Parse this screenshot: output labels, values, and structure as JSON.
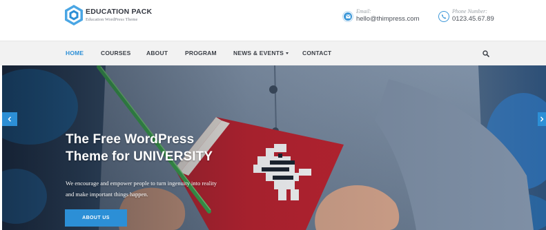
{
  "brand": {
    "name": "EDUCATION PACK",
    "tagline": "Education WordPress Theme",
    "accent_color": "#2c8fd6"
  },
  "contact": {
    "email_label": "Email:",
    "email_value": "hello@thimpress.com",
    "phone_label": "Phone Number:",
    "phone_value": "0123.45.67.89"
  },
  "nav": {
    "items": [
      {
        "label": "HOME",
        "active": true
      },
      {
        "label": "COURSES",
        "active": false
      },
      {
        "label": "ABOUT",
        "active": false
      },
      {
        "label": "PROGRAM",
        "active": false
      },
      {
        "label": "NEWS & EVENTS",
        "active": false,
        "has_dropdown": true
      },
      {
        "label": "CONTACT",
        "active": false
      }
    ],
    "search_icon": "search-icon"
  },
  "hero": {
    "title_line1": "The Free WordPress",
    "title_line2": "Theme for UNIVERSITY",
    "desc_line1": "We encourage and empower people to turn ingenuity into reality",
    "desc_line2": "and make important things happen.",
    "button_label": "ABOUT US",
    "prev_icon": "chevron-left-icon",
    "next_icon": "chevron-right-icon"
  }
}
